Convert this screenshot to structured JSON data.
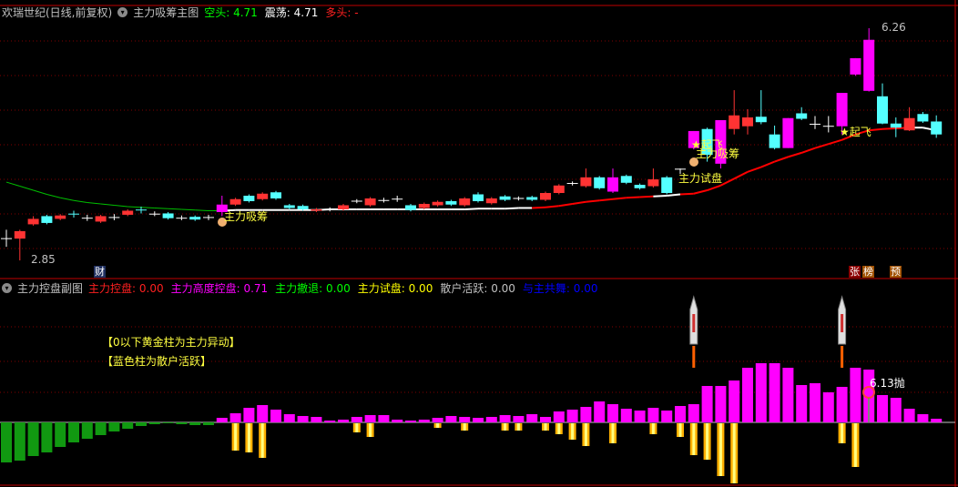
{
  "main_header": {
    "stock": "欢瑞世纪(日线,前复权)",
    "indicator": "主力吸筹主图",
    "items": [
      {
        "label": "空头: ",
        "value": "4.71",
        "color": "#00ff00"
      },
      {
        "label": "震荡: ",
        "value": "4.71",
        "color": "#ffffff"
      },
      {
        "label": "多头: ",
        "value": "-",
        "color": "#ff2020"
      }
    ]
  },
  "sub_header": {
    "indicator": "主力控盘副图",
    "items": [
      {
        "label": "主力控盘: ",
        "value": "0.00",
        "color": "#ff2020"
      },
      {
        "label": "主力高度控盘: ",
        "value": "0.71",
        "color": "#ff00ff"
      },
      {
        "label": "主力撤退: ",
        "value": "0.00",
        "color": "#00ff00"
      },
      {
        "label": "主力试盘: ",
        "value": "0.00",
        "color": "#ffff00"
      },
      {
        "label": "散户活跃: ",
        "value": "0.00",
        "color": "#c0c0c0"
      },
      {
        "label": "与主共舞: ",
        "value": "0.00",
        "color": "#0000ff"
      }
    ]
  },
  "annotations": {
    "high": "6.26",
    "low": "2.85",
    "absorb1": "主力吸筹",
    "absorb2": "主力吸筹",
    "test": "主力试盘",
    "takeoff1": "★起飞",
    "takeoff2": "★起飞",
    "note1": "【0以下黄金柱为主力异动】",
    "note2": "【蓝色柱为散户活跃】",
    "sell": "6.13抛"
  },
  "badges": {
    "cai": "财",
    "zhang": "张",
    "bang": "榜",
    "yu": "预"
  },
  "colors": {
    "up": "#ff3333",
    "down": "#54ffff",
    "special": "#ff00ff",
    "flat": "#ffffff",
    "ma_red": "#ff0000",
    "ma_green": "#00c000",
    "gold": "#ffb000",
    "grid": "#800000"
  },
  "chart_data": {
    "type": "candlestick",
    "price_range": [
      2.85,
      6.26
    ],
    "candles": [
      [
        3.17,
        3.17,
        3.3,
        3.05,
        "w"
      ],
      [
        3.17,
        3.28,
        3.3,
        2.85,
        "r"
      ],
      [
        3.38,
        3.46,
        3.5,
        3.36,
        "r"
      ],
      [
        3.5,
        3.4,
        3.52,
        3.38,
        "c"
      ],
      [
        3.46,
        3.51,
        3.53,
        3.44,
        "r"
      ],
      [
        3.53,
        3.53,
        3.58,
        3.48,
        "c"
      ],
      [
        3.47,
        3.47,
        3.52,
        3.43,
        "w"
      ],
      [
        3.42,
        3.5,
        3.52,
        3.4,
        "r"
      ],
      [
        3.48,
        3.48,
        3.53,
        3.44,
        "w"
      ],
      [
        3.52,
        3.58,
        3.6,
        3.5,
        "r"
      ],
      [
        3.59,
        3.59,
        3.64,
        3.54,
        "c"
      ],
      [
        3.53,
        3.53,
        3.57,
        3.5,
        "w"
      ],
      [
        3.54,
        3.47,
        3.56,
        3.45,
        "c"
      ],
      [
        3.47,
        3.47,
        3.51,
        3.44,
        "w"
      ],
      [
        3.49,
        3.45,
        3.51,
        3.43,
        "c"
      ],
      [
        3.48,
        3.48,
        3.52,
        3.44,
        "w"
      ],
      [
        3.56,
        3.67,
        3.8,
        3.5,
        "m"
      ],
      [
        3.67,
        3.75,
        3.77,
        3.65,
        "r"
      ],
      [
        3.8,
        3.72,
        3.82,
        3.7,
        "c"
      ],
      [
        3.75,
        3.83,
        3.85,
        3.73,
        "r"
      ],
      [
        3.85,
        3.76,
        3.87,
        3.74,
        "c"
      ],
      [
        3.66,
        3.62,
        3.68,
        3.6,
        "c"
      ],
      [
        3.65,
        3.6,
        3.67,
        3.58,
        "c"
      ],
      [
        3.58,
        3.6,
        3.62,
        3.56,
        "r"
      ],
      [
        3.6,
        3.6,
        3.63,
        3.57,
        "w"
      ],
      [
        3.6,
        3.66,
        3.68,
        3.58,
        "r"
      ],
      [
        3.72,
        3.72,
        3.75,
        3.69,
        "w"
      ],
      [
        3.66,
        3.76,
        3.78,
        3.64,
        "r"
      ],
      [
        3.73,
        3.73,
        3.77,
        3.7,
        "w"
      ],
      [
        3.75,
        3.75,
        3.8,
        3.71,
        "w"
      ],
      [
        3.66,
        3.59,
        3.68,
        3.57,
        "c"
      ],
      [
        3.62,
        3.68,
        3.7,
        3.6,
        "r"
      ],
      [
        3.66,
        3.71,
        3.73,
        3.64,
        "r"
      ],
      [
        3.72,
        3.67,
        3.74,
        3.65,
        "c"
      ],
      [
        3.66,
        3.76,
        3.78,
        3.64,
        "r"
      ],
      [
        3.82,
        3.72,
        3.85,
        3.7,
        "c"
      ],
      [
        3.69,
        3.76,
        3.78,
        3.67,
        "r"
      ],
      [
        3.79,
        3.74,
        3.81,
        3.72,
        "c"
      ],
      [
        3.76,
        3.76,
        3.79,
        3.73,
        "w"
      ],
      [
        3.78,
        3.74,
        3.8,
        3.72,
        "c"
      ],
      [
        3.74,
        3.84,
        3.86,
        3.72,
        "r"
      ],
      [
        3.84,
        3.95,
        3.97,
        3.82,
        "r"
      ],
      [
        3.98,
        3.98,
        4.01,
        3.95,
        "w"
      ],
      [
        3.94,
        4.07,
        4.2,
        3.92,
        "r"
      ],
      [
        4.07,
        3.91,
        4.09,
        3.89,
        "c"
      ],
      [
        3.86,
        4.07,
        4.2,
        3.84,
        "m"
      ],
      [
        4.09,
        3.99,
        4.11,
        3.97,
        "c"
      ],
      [
        3.96,
        3.91,
        3.98,
        3.89,
        "c"
      ],
      [
        3.94,
        4.04,
        4.2,
        3.92,
        "r"
      ],
      [
        4.07,
        3.84,
        4.09,
        3.82,
        "c"
      ],
      [
        4.19,
        4.19,
        4.2,
        4.12,
        "w"
      ],
      [
        4.5,
        4.75,
        4.75,
        4.48,
        "m"
      ],
      [
        4.78,
        4.4,
        4.8,
        4.3,
        "c"
      ],
      [
        4.27,
        4.91,
        4.91,
        4.2,
        "m"
      ],
      [
        4.78,
        4.98,
        5.35,
        4.7,
        "r"
      ],
      [
        4.82,
        4.95,
        5.07,
        4.7,
        "r"
      ],
      [
        4.96,
        4.88,
        5.35,
        4.85,
        "c"
      ],
      [
        4.7,
        4.5,
        4.83,
        4.48,
        "c"
      ],
      [
        4.5,
        4.94,
        4.94,
        4.5,
        "m"
      ],
      [
        5.01,
        4.93,
        5.1,
        4.91,
        "c"
      ],
      [
        4.85,
        4.85,
        4.97,
        4.78,
        "w"
      ],
      [
        4.82,
        4.82,
        4.97,
        4.73,
        "w"
      ],
      [
        4.82,
        5.31,
        5.31,
        4.7,
        "m"
      ],
      [
        5.58,
        5.82,
        5.82,
        5.56,
        "m"
      ],
      [
        5.34,
        6.09,
        6.26,
        5.33,
        "m"
      ],
      [
        5.26,
        4.86,
        5.45,
        4.85,
        "c"
      ],
      [
        4.86,
        4.8,
        4.95,
        4.66,
        "c"
      ],
      [
        4.76,
        4.94,
        5.1,
        4.75,
        "r"
      ],
      [
        5.0,
        4.89,
        5.03,
        4.87,
        "c"
      ],
      [
        4.89,
        4.7,
        4.98,
        4.65,
        "c"
      ]
    ],
    "ma": [
      4.0,
      3.94,
      3.88,
      3.82,
      3.77,
      3.73,
      3.7,
      3.68,
      3.66,
      3.64,
      3.63,
      3.62,
      3.61,
      3.6,
      3.59,
      3.58,
      3.58,
      3.59,
      3.59,
      3.59,
      3.59,
      3.59,
      3.59,
      3.59,
      3.6,
      3.6,
      3.6,
      3.6,
      3.6,
      3.6,
      3.6,
      3.6,
      3.6,
      3.6,
      3.6,
      3.61,
      3.61,
      3.61,
      3.62,
      3.62,
      3.63,
      3.65,
      3.68,
      3.71,
      3.73,
      3.75,
      3.77,
      3.78,
      3.79,
      3.8,
      3.82,
      3.83,
      3.88,
      3.95,
      4.05,
      4.15,
      4.22,
      4.3,
      4.37,
      4.43,
      4.5,
      4.56,
      4.62,
      4.7,
      4.76,
      4.78,
      4.79,
      4.8,
      4.8,
      4.76
    ],
    "ma_color": [
      "g",
      "g",
      "g",
      "g",
      "g",
      "g",
      "g",
      "g",
      "g",
      "g",
      "g",
      "g",
      "g",
      "g",
      "g",
      "g",
      "g",
      "w",
      "w",
      "w",
      "w",
      "w",
      "w",
      "w",
      "w",
      "w",
      "w",
      "w",
      "w",
      "w",
      "w",
      "w",
      "w",
      "w",
      "w",
      "w",
      "w",
      "w",
      "w",
      "w",
      "r",
      "r",
      "r",
      "r",
      "r",
      "r",
      "r",
      "r",
      "r",
      "w",
      "w",
      "r",
      "r",
      "r",
      "r",
      "r",
      "r",
      "r",
      "r",
      "r",
      "r",
      "r",
      "r",
      "r",
      "r",
      "r",
      "r",
      "r",
      "w",
      "w"
    ],
    "sub": {
      "main": [
        -44,
        -42,
        -37,
        -33,
        -27,
        -22,
        -18,
        -14,
        -10,
        -7,
        -4,
        -2,
        -1,
        -2,
        -3,
        -3,
        5,
        10,
        16,
        19,
        14,
        9,
        7,
        6,
        2,
        3,
        6,
        8,
        8,
        3,
        2,
        3,
        5,
        7,
        6,
        5,
        6,
        8,
        7,
        9,
        6,
        12,
        14,
        17,
        23,
        20,
        15,
        13,
        16,
        13,
        18,
        20,
        40,
        40,
        46,
        60,
        65,
        65,
        60,
        41,
        43,
        33,
        39,
        60,
        58,
        30,
        27,
        15,
        9,
        4
      ],
      "gold": {
        "17": -30,
        "18": -32,
        "19": -38,
        "26": -10,
        "27": -15,
        "32": -5,
        "34": -8,
        "37": -8,
        "38": -8,
        "40": -8,
        "41": -12,
        "42": -18,
        "43": -25,
        "45": -22,
        "48": -12,
        "50": -15,
        "51": -35,
        "52": -40,
        "53": -58,
        "54": -66,
        "62": -22,
        "63": -48
      },
      "rockets": [
        51,
        62
      ]
    }
  }
}
